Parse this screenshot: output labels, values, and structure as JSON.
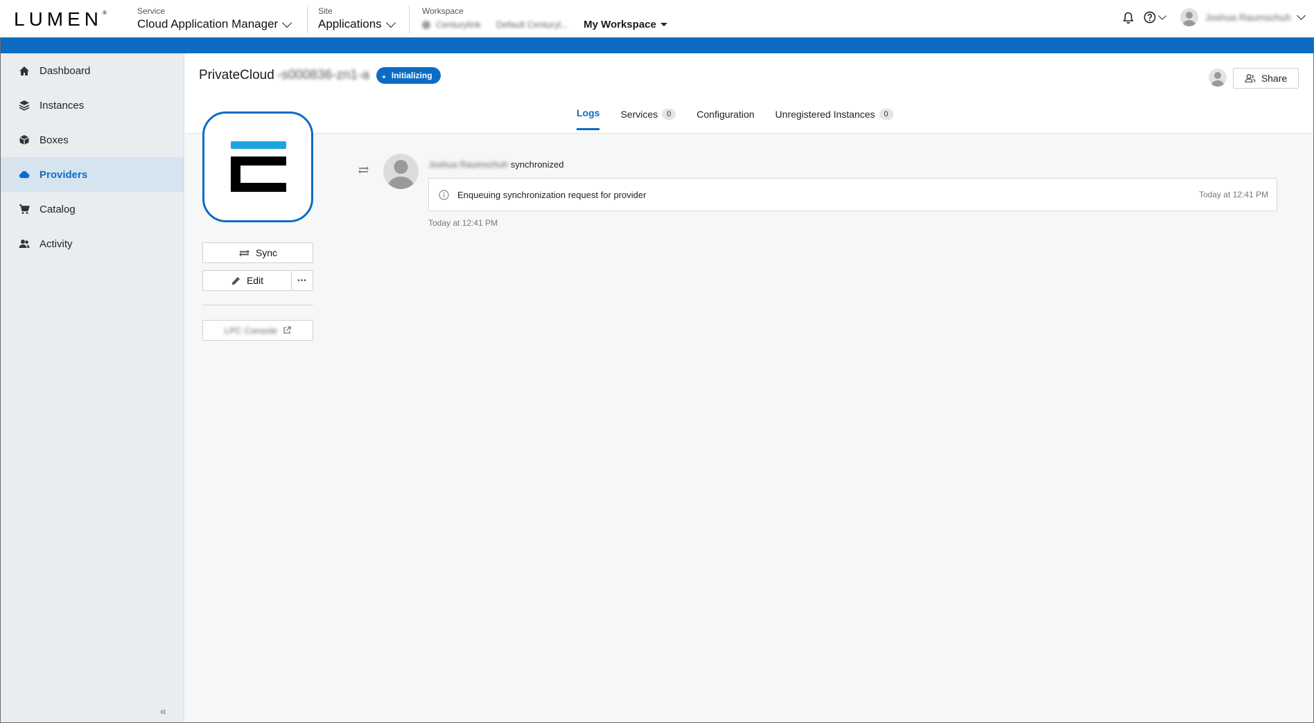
{
  "header": {
    "logo": "LUMEN",
    "service_label": "Service",
    "service_value": "Cloud Application Manager",
    "site_label": "Site",
    "site_value": "Applications",
    "workspace_label": "Workspace",
    "workspace_org": "Centurylink",
    "workspace_name": "Default Centuryl...",
    "my_workspace": "My Workspace",
    "user_name": "Joshua Raumschuh"
  },
  "sidebar": {
    "items": [
      {
        "label": "Dashboard",
        "icon": "home-icon"
      },
      {
        "label": "Instances",
        "icon": "layers-icon"
      },
      {
        "label": "Boxes",
        "icon": "box-icon"
      },
      {
        "label": "Providers",
        "icon": "cloud-icon"
      },
      {
        "label": "Catalog",
        "icon": "cart-icon"
      },
      {
        "label": "Activity",
        "icon": "users-icon"
      }
    ],
    "active": "Providers",
    "collapse": "«"
  },
  "page": {
    "title": "PrivateCloud",
    "title_suffix": "-s000836-zn1-a",
    "status": "Initializing",
    "share": "Share"
  },
  "tabs": [
    {
      "label": "Logs",
      "count": null
    },
    {
      "label": "Services",
      "count": "0"
    },
    {
      "label": "Configuration",
      "count": null
    },
    {
      "label": "Unregistered Instances",
      "count": "0"
    }
  ],
  "actions": {
    "sync": "Sync",
    "edit": "Edit",
    "more": "•••",
    "console": "LPC Console"
  },
  "log": {
    "user": "Joshua Raumschuh",
    "action": "synchronized",
    "message": "Enqueuing synchronization request for provider",
    "time": "Today at 12:41 PM",
    "footer_time": "Today at 12:41 PM"
  },
  "colors": {
    "brand_blue": "#0c6cc4",
    "logo_light_blue": "#1da4dc"
  }
}
